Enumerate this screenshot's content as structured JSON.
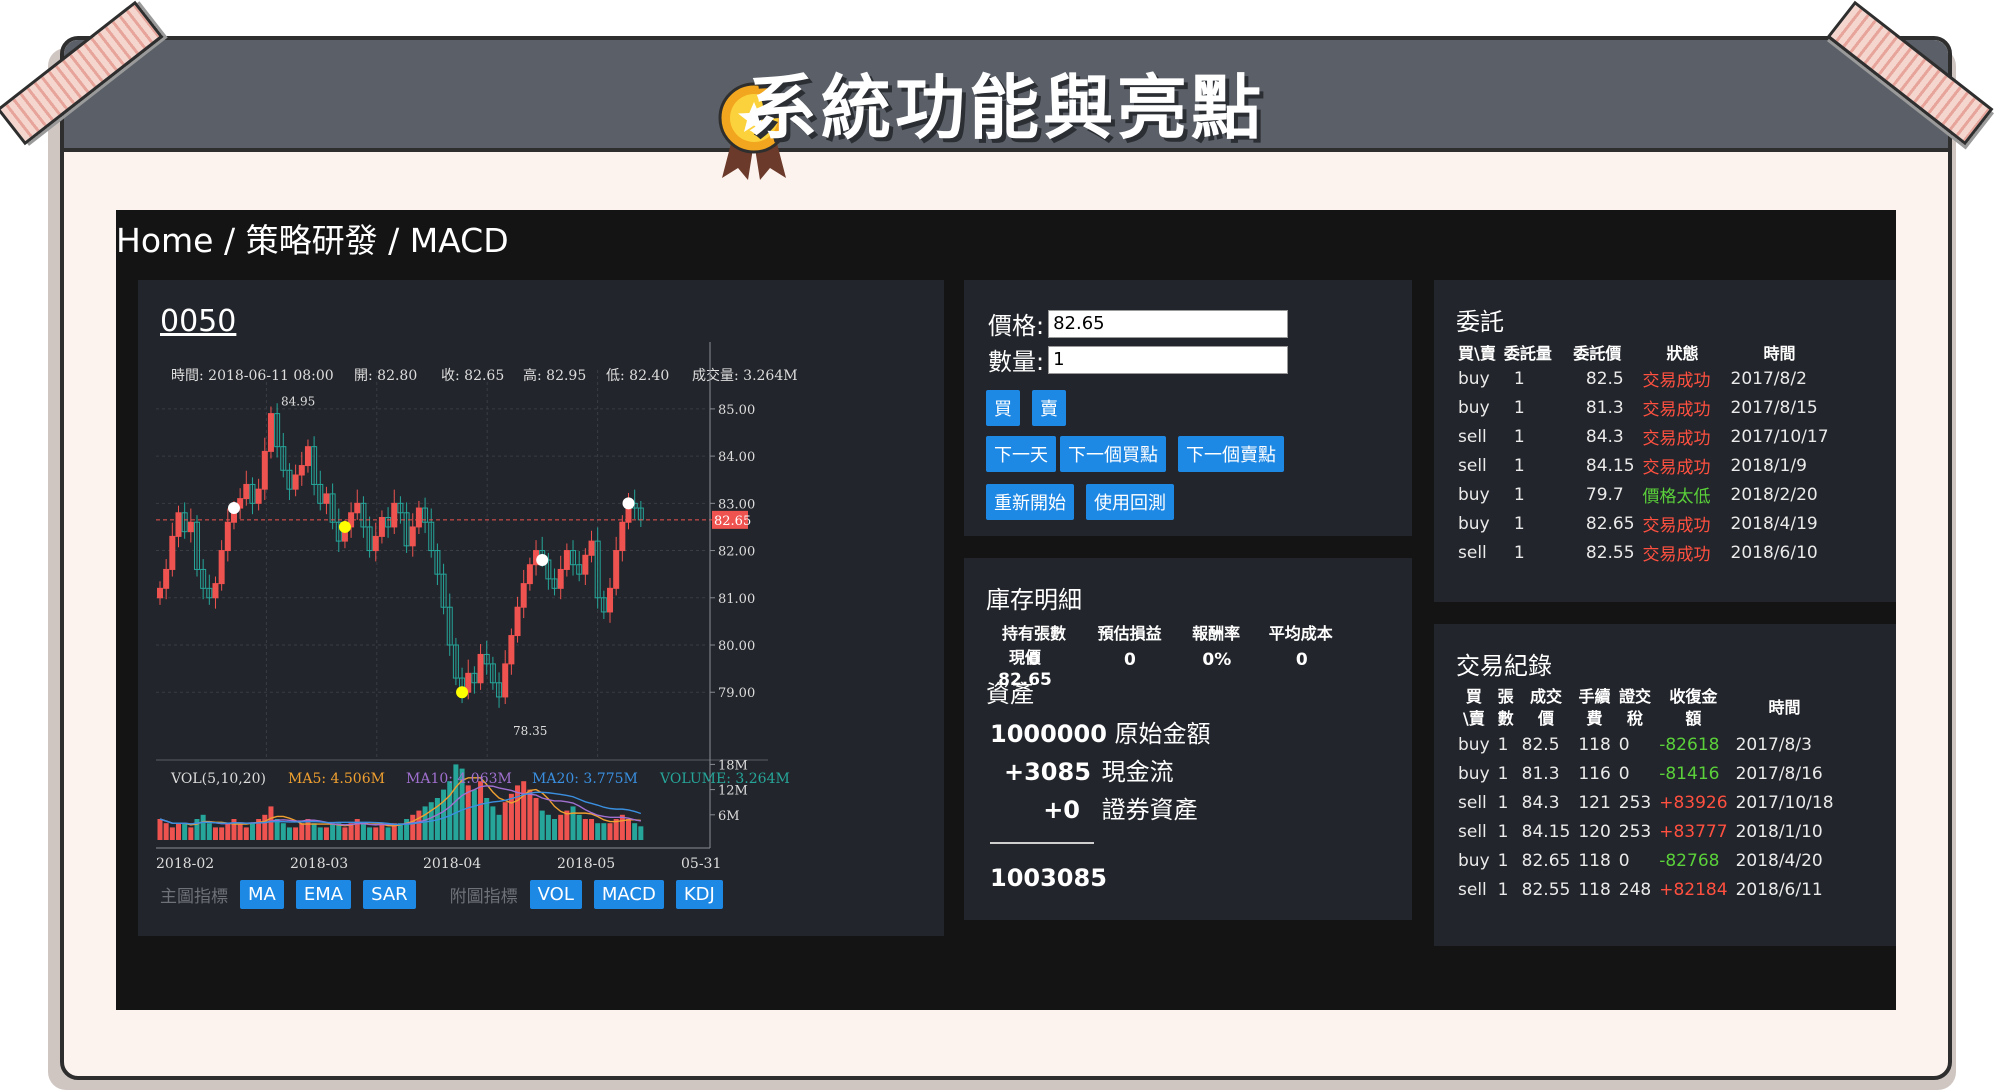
{
  "banner": {
    "title": "系統功能與亮點"
  },
  "breadcrumb": {
    "home": "Home",
    "sep1": "/",
    "section": "策略研發",
    "sep2": "/",
    "page": "MACD"
  },
  "chart": {
    "ticker": "0050",
    "info": {
      "time": "時間: 2018-06-11 08:00",
      "open": "開: 82.80",
      "close": "收: 82.65",
      "high": "高: 82.95",
      "low": "低: 82.40",
      "volume": "成交量: 3.264M"
    },
    "vol_legend": {
      "title": "VOL(5,10,20)",
      "ma5": "MA5: 4.506M",
      "ma10": "MA10: 4.063M",
      "ma20": "MA20: 3.775M",
      "volume": "VOLUME: 3.264M"
    },
    "indicators": {
      "main_label": "主圖指標",
      "main": [
        "MA",
        "EMA",
        "SAR"
      ],
      "sub_label": "附圖指標",
      "sub": [
        "VOL",
        "MACD",
        "KDJ"
      ]
    }
  },
  "chart_data": {
    "type": "candlestick",
    "price_axis": {
      "ticks": [
        "85.00",
        "84.00",
        "83.00",
        "82.00",
        "81.00",
        "80.00",
        "79.00"
      ],
      "ylim": [
        78.2,
        85.4
      ]
    },
    "volume_axis": {
      "ticks": [
        "18M",
        "12M",
        "6M"
      ],
      "ylim": [
        0,
        20
      ]
    },
    "x_ticks": [
      "2018-02",
      "2018-03",
      "2018-04",
      "2018-05",
      "05-31"
    ],
    "current_price": "82.65",
    "max_label": "84.95",
    "min_label": "78.35",
    "closes": [
      81.2,
      81.6,
      82.3,
      82.8,
      82.4,
      82.6,
      81.6,
      81.2,
      81.0,
      81.3,
      82.0,
      82.6,
      82.9,
      83.1,
      83.4,
      83.0,
      83.3,
      84.1,
      84.9,
      84.2,
      83.7,
      83.3,
      83.6,
      83.8,
      84.2,
      83.4,
      83.0,
      83.2,
      82.6,
      82.2,
      82.5,
      82.8,
      83.0,
      82.5,
      82.0,
      82.3,
      82.7,
      82.5,
      83.0,
      82.8,
      82.1,
      82.5,
      82.9,
      82.6,
      82.0,
      81.5,
      80.8,
      80.0,
      79.3,
      79.0,
      79.4,
      79.2,
      79.8,
      79.6,
      79.2,
      78.9,
      79.6,
      80.2,
      80.8,
      81.3,
      81.7,
      82.0,
      81.8,
      81.4,
      81.2,
      81.6,
      82.0,
      81.7,
      81.5,
      81.9,
      82.2,
      81.0,
      80.7,
      81.2,
      82.0,
      82.6,
      83.0,
      82.9,
      82.65
    ],
    "volumes": [
      5,
      4,
      3,
      4,
      4,
      3,
      5,
      6,
      4,
      3,
      3,
      4,
      5,
      4,
      3,
      4,
      5,
      6,
      8,
      5,
      4,
      3,
      3,
      4,
      5,
      4,
      3,
      3,
      4,
      4,
      3,
      4,
      5,
      4,
      3,
      3,
      4,
      3,
      4,
      4,
      5,
      6,
      7,
      8,
      9,
      10,
      12,
      14,
      18,
      17,
      13,
      12,
      14,
      10,
      8,
      6,
      9,
      11,
      13,
      14,
      12,
      10,
      7,
      6,
      5,
      6,
      7,
      8,
      6,
      5,
      5,
      4,
      4,
      4,
      5,
      6,
      5,
      4,
      3.26
    ],
    "series": [
      {
        "name": "MA5",
        "color": "#f0a030"
      },
      {
        "name": "MA10",
        "color": "#a070d0"
      },
      {
        "name": "MA20",
        "color": "#3a8fe0"
      }
    ]
  },
  "trade": {
    "price_label": "價格:",
    "price_value": "82.65",
    "qty_label": "數量:",
    "qty_value": "1",
    "buy": "買",
    "sell": "賣",
    "next_day": "下一天",
    "next_buy": "下一個買點",
    "next_sell": "下一個賣點",
    "restart": "重新開始",
    "backtest": "使用回測"
  },
  "inventory": {
    "title": "庫存明細",
    "headers": [
      "持有張數",
      "預估損益",
      "報酬率",
      "平均成本",
      "現價"
    ],
    "values": [
      "0",
      "0",
      "0%",
      "0",
      "82.65"
    ],
    "assets_title": "資產",
    "original_value": "1000000",
    "original_label": "原始金額",
    "cashflow_value": "+3085",
    "cashflow_label": "現金流",
    "securities_value": "+0",
    "securities_label": "證券資產",
    "total": "1003085"
  },
  "orders": {
    "title": "委託",
    "headers": [
      "買\\賣",
      "委託量",
      "委託價",
      "狀態",
      "時間"
    ],
    "rows": [
      {
        "side": "buy",
        "qty": "1",
        "price": "82.5",
        "status": "交易成功",
        "status_color": "#ff5040",
        "time": "2017/8/2"
      },
      {
        "side": "buy",
        "qty": "1",
        "price": "81.3",
        "status": "交易成功",
        "status_color": "#ff5040",
        "time": "2017/8/15"
      },
      {
        "side": "sell",
        "qty": "1",
        "price": "84.3",
        "status": "交易成功",
        "status_color": "#ff5040",
        "time": "2017/10/17"
      },
      {
        "side": "sell",
        "qty": "1",
        "price": "84.15",
        "status": "交易成功",
        "status_color": "#ff5040",
        "time": "2018/1/9"
      },
      {
        "side": "buy",
        "qty": "1",
        "price": "79.7",
        "status": "價格太低",
        "status_color": "#5ad03a",
        "time": "2018/2/20"
      },
      {
        "side": "buy",
        "qty": "1",
        "price": "82.65",
        "status": "交易成功",
        "status_color": "#ff5040",
        "time": "2018/4/19"
      },
      {
        "side": "sell",
        "qty": "1",
        "price": "82.55",
        "status": "交易成功",
        "status_color": "#ff5040",
        "time": "2018/6/10"
      }
    ]
  },
  "history": {
    "title": "交易紀錄",
    "headers": [
      [
        "買",
        "\\賣"
      ],
      [
        "張",
        "數"
      ],
      [
        "成交",
        "價"
      ],
      [
        "手續",
        "費"
      ],
      [
        "證交",
        "稅"
      ],
      [
        "收復金",
        "額"
      ],
      [
        "時間",
        ""
      ]
    ],
    "rows": [
      {
        "side": "buy",
        "qty": "1",
        "price": "82.5",
        "fee": "118",
        "tax": "0",
        "amount": "-82618",
        "amount_color": "#5ad03a",
        "time": "2017/8/3"
      },
      {
        "side": "buy",
        "qty": "1",
        "price": "81.3",
        "fee": "116",
        "tax": "0",
        "amount": "-81416",
        "amount_color": "#5ad03a",
        "time": "2017/8/16"
      },
      {
        "side": "sell",
        "qty": "1",
        "price": "84.3",
        "fee": "121",
        "tax": "253",
        "amount": "+83926",
        "amount_color": "#ff5040",
        "time": "2017/10/18"
      },
      {
        "side": "sell",
        "qty": "1",
        "price": "84.15",
        "fee": "120",
        "tax": "253",
        "amount": "+83777",
        "amount_color": "#ff5040",
        "time": "2018/1/10"
      },
      {
        "side": "buy",
        "qty": "1",
        "price": "82.65",
        "fee": "118",
        "tax": "0",
        "amount": "-82768",
        "amount_color": "#5ad03a",
        "time": "2018/4/20"
      },
      {
        "side": "sell",
        "qty": "1",
        "price": "82.55",
        "fee": "118",
        "tax": "248",
        "amount": "+82184",
        "amount_color": "#ff5040",
        "time": "2018/6/11"
      }
    ]
  }
}
